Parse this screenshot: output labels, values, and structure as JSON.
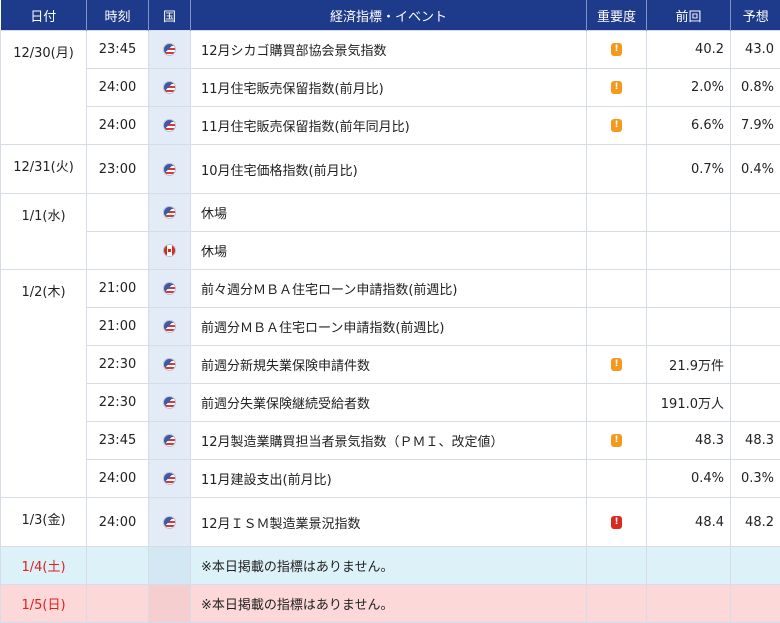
{
  "header": {
    "date": "日付",
    "time": "時刻",
    "country": "国",
    "event": "経済指標・イベント",
    "importance": "重要度",
    "previous": "前回",
    "forecast": "予想"
  },
  "days": [
    {
      "date": "12/30(月)",
      "type": "weekday",
      "rows": [
        {
          "time": "23:45",
          "flag": "us-flag-icon",
          "event": "12月シカゴ購買部協会景気指数",
          "importance": "medium",
          "previous": "40.2",
          "forecast": "43.0"
        },
        {
          "time": "24:00",
          "flag": "us-flag-icon",
          "event": "11月住宅販売保留指数(前月比)",
          "importance": "medium",
          "previous": "2.0%",
          "forecast": "0.8%"
        },
        {
          "time": "24:00",
          "flag": "us-flag-icon",
          "event": "11月住宅販売保留指数(前年同月比)",
          "importance": "medium",
          "previous": "6.6%",
          "forecast": "7.9%"
        }
      ]
    },
    {
      "date": "12/31(火)",
      "type": "weekday",
      "rows": [
        {
          "time": "23:00",
          "flag": "us-flag-icon",
          "event": "10月住宅価格指数(前月比)",
          "importance": "",
          "previous": "0.7%",
          "forecast": "0.4%"
        }
      ]
    },
    {
      "date": "1/1(水)",
      "type": "weekday",
      "rows": [
        {
          "time": "",
          "flag": "us-flag-icon",
          "event": "休場",
          "importance": "",
          "previous": "",
          "forecast": ""
        },
        {
          "time": "",
          "flag": "ca-flag-icon",
          "event": "休場",
          "importance": "",
          "previous": "",
          "forecast": ""
        }
      ]
    },
    {
      "date": "1/2(木)",
      "type": "weekday",
      "rows": [
        {
          "time": "21:00",
          "flag": "us-flag-icon",
          "event": "前々週分ＭＢＡ住宅ローン申請指数(前週比)",
          "importance": "",
          "previous": "",
          "forecast": ""
        },
        {
          "time": "21:00",
          "flag": "us-flag-icon",
          "event": "前週分ＭＢＡ住宅ローン申請指数(前週比)",
          "importance": "",
          "previous": "",
          "forecast": ""
        },
        {
          "time": "22:30",
          "flag": "us-flag-icon",
          "event": "前週分新規失業保険申請件数",
          "importance": "medium",
          "previous": "21.9万件",
          "forecast": ""
        },
        {
          "time": "22:30",
          "flag": "us-flag-icon",
          "event": "前週分失業保険継続受給者数",
          "importance": "",
          "previous": "191.0万人",
          "forecast": ""
        },
        {
          "time": "23:45",
          "flag": "us-flag-icon",
          "event": "12月製造業購買担当者景気指数（ＰＭＩ、改定値）",
          "importance": "medium",
          "previous": "48.3",
          "forecast": "48.3"
        },
        {
          "time": "24:00",
          "flag": "us-flag-icon",
          "event": "11月建設支出(前月比)",
          "importance": "",
          "previous": "0.4%",
          "forecast": "0.3%"
        }
      ]
    },
    {
      "date": "1/3(金)",
      "type": "weekday",
      "rows": [
        {
          "time": "24:00",
          "flag": "us-flag-icon",
          "event": "12月ＩＳＭ製造業景況指数",
          "importance": "high",
          "previous": "48.4",
          "forecast": "48.2"
        }
      ]
    },
    {
      "date": "1/4(土)",
      "type": "sat",
      "rows": [
        {
          "time": "",
          "flag": "",
          "event": "※本日掲載の指標はありません。",
          "importance": "",
          "previous": "",
          "forecast": ""
        }
      ]
    },
    {
      "date": "1/5(日)",
      "type": "sun",
      "rows": [
        {
          "time": "",
          "flag": "",
          "event": "※本日掲載の指標はありません。",
          "importance": "",
          "previous": "",
          "forecast": ""
        }
      ]
    }
  ],
  "importance_glyphs": {
    "medium": "!",
    "high": "!"
  },
  "colors": {
    "header_bg": "#1e3a8a",
    "medium": "#f39a1e",
    "high": "#d72a20",
    "saturday_bg": "#ddf1f8",
    "sunday_bg": "#fdd8d8",
    "weekend_date": "#e02020"
  }
}
